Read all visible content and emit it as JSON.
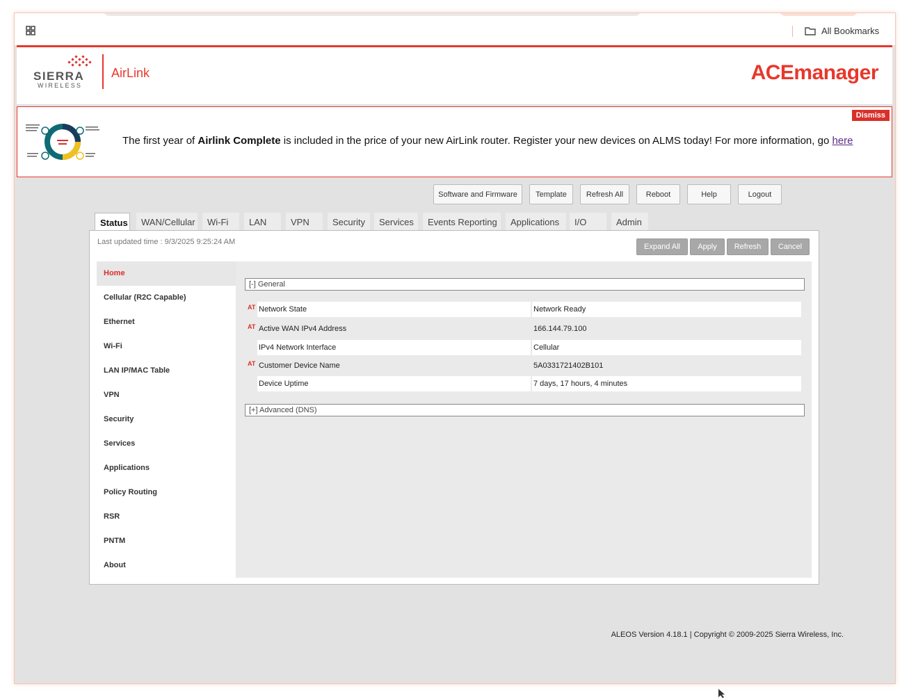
{
  "browser": {
    "bookmarks_label": "All Bookmarks"
  },
  "header": {
    "brand_sierra": "SIERRA",
    "brand_wireless": "WIRELESS",
    "brand_airlink": "AirLink",
    "app_title": "ACEmanager"
  },
  "banner": {
    "text_before": "The first year of ",
    "text_bold": "Airlink Complete",
    "text_after": " is included in the price of your new AirLink router. Register your new devices on ALMS today! For more information, go ",
    "link_text": "here",
    "dismiss_label": "Dismiss"
  },
  "top_buttons": {
    "software_firmware": "Software and Firmware",
    "template": "Template",
    "refresh_all": "Refresh All",
    "reboot": "Reboot",
    "help": "Help",
    "logout": "Logout"
  },
  "tabs": {
    "status": "Status",
    "wan": "WAN/Cellular",
    "wifi": "Wi-Fi",
    "lan": "LAN",
    "vpn": "VPN",
    "security": "Security",
    "services": "Services",
    "events": "Events Reporting",
    "applications": "Applications",
    "io": "I/O",
    "admin": "Admin"
  },
  "panel": {
    "last_updated": "Last updated time : 9/3/2025 9:25:24 AM",
    "expand_all": "Expand All",
    "apply": "Apply",
    "refresh": "Refresh",
    "cancel": "Cancel"
  },
  "side_nav": {
    "home": "Home",
    "cellular": "Cellular (R2C Capable)",
    "ethernet": "Ethernet",
    "wifi": "Wi-Fi",
    "lan_ipmac": "LAN IP/MAC Table",
    "vpn": "VPN",
    "security": "Security",
    "services": "Services",
    "applications": "Applications",
    "policy_routing": "Policy Routing",
    "rsr": "RSR",
    "pntm": "PNTM",
    "about": "About"
  },
  "general": {
    "header": "[-] General",
    "at_marker": "AT",
    "rows": [
      {
        "label": "Network State",
        "value": "Network Ready"
      },
      {
        "label": "Active WAN IPv4 Address",
        "value": "166.144.79.100"
      },
      {
        "label": "IPv4 Network Interface",
        "value": "Cellular"
      },
      {
        "label": "Customer Device Name",
        "value": "5A0331721402B101"
      },
      {
        "label": "Device Uptime",
        "value": "7 days, 17 hours, 4 minutes"
      }
    ]
  },
  "advanced": {
    "header": "[+] Advanced (DNS)"
  },
  "footer": {
    "text": "ALEOS Version 4.18.1 | Copyright © 2009-2025 Sierra Wireless, Inc."
  }
}
